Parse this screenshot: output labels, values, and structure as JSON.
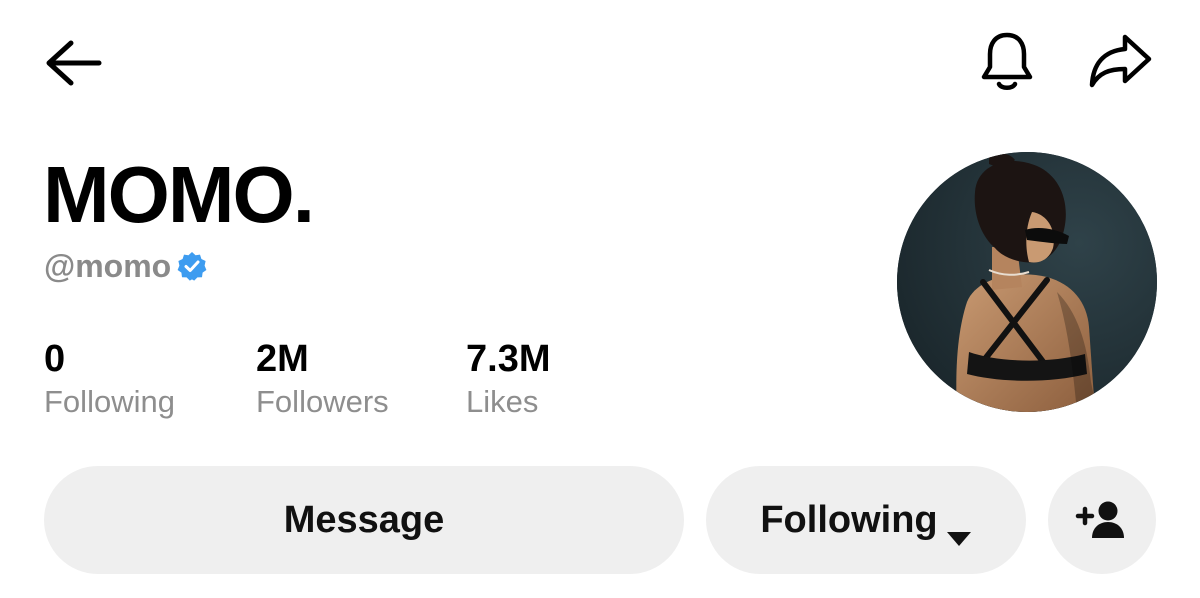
{
  "header": {
    "back_icon": "arrow-left-icon",
    "notification_icon": "bell-icon",
    "share_icon": "share-forward-icon"
  },
  "profile": {
    "display_name": "MOMO.",
    "handle": "@momo",
    "verified": true,
    "verified_badge_color": "#3d9cf0",
    "avatar_icon": "profile-photo"
  },
  "stats": [
    {
      "value": "0",
      "label": "Following"
    },
    {
      "value": "2M",
      "label": "Followers"
    },
    {
      "value": "7.3M",
      "label": "Likes"
    }
  ],
  "actions": {
    "message_label": "Message",
    "following_label": "Following",
    "following_dropdown_icon": "caret-down-icon",
    "add_friend_icon": "add-user-icon"
  },
  "colors": {
    "button_bg": "#efefef",
    "muted_text": "#8e8e8e",
    "primary_text": "#000000"
  }
}
